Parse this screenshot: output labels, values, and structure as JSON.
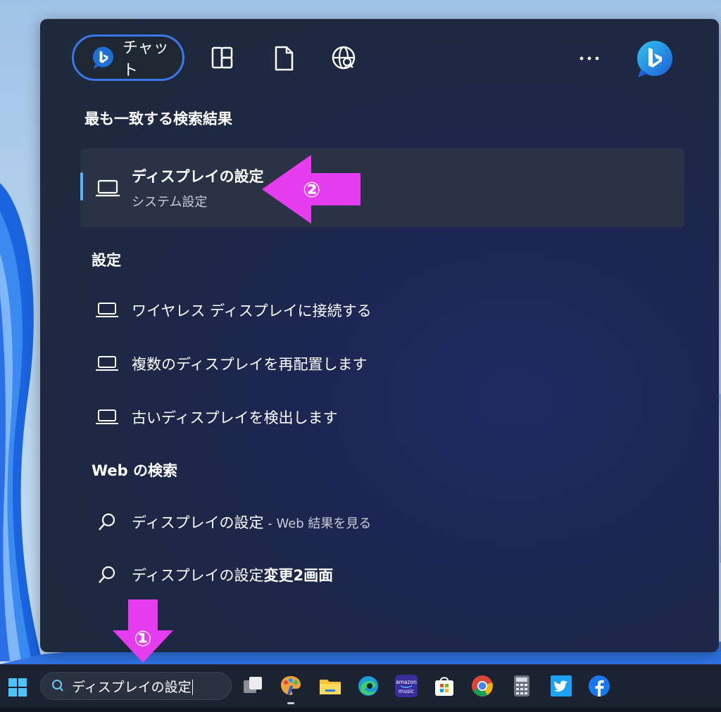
{
  "panel": {
    "chat_label": "チャット",
    "heading_best": "最も一致する検索結果",
    "best_match": {
      "title": "ディスプレイの設定",
      "subtitle": "システム設定"
    },
    "heading_settings": "設定",
    "settings_items": [
      {
        "label": "ワイヤレス ディスプレイに接続する",
        "icon": "laptop-icon"
      },
      {
        "label": "複数のディスプレイを再配置します",
        "icon": "laptop-icon"
      },
      {
        "label": "古いディスプレイを検出します",
        "icon": "laptop-icon"
      }
    ],
    "heading_web": "Web の検索",
    "web_items": [
      {
        "label": "ディスプレイの設定",
        "suffix": " - Web 結果を見る",
        "icon": "search-icon"
      },
      {
        "label": "ディスプレイの設定",
        "suffix": "変更2画面",
        "icon": "search-icon"
      }
    ],
    "top_icons": [
      "bing-chat-icon",
      "apps-grid-icon",
      "document-icon",
      "globe-search-icon",
      "more-icon",
      "bing-logo-icon"
    ]
  },
  "annotations": {
    "marker1": "①",
    "marker2": "②"
  },
  "taskbar": {
    "search_value": "ディスプレイの設定",
    "apps": [
      "windows-start-icon",
      "task-view-icon",
      "paint-icon",
      "file-explorer-icon",
      "edge-icon",
      "amazon-music-icon",
      "store-icon",
      "chrome-icon",
      "calculator-icon",
      "twitter-icon",
      "facebook-icon"
    ],
    "amazon_label_top": "amazon",
    "amazon_label_bottom": "music"
  },
  "colors": {
    "accent": "#5ab1f5",
    "annotation_magenta": "#e63cf0",
    "chat_border": "#3a78e8"
  }
}
